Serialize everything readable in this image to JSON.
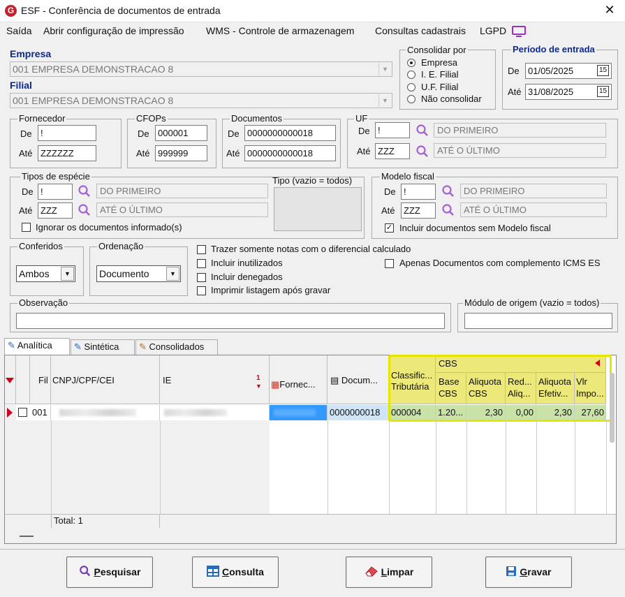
{
  "window": {
    "title": "ESF - Conferência de documentos de entrada",
    "logo_letter": "G"
  },
  "menu": [
    "Saída",
    "Abrir configuração de impressão",
    "WMS - Controle de armazenagem",
    "Consultas cadastrais",
    "LGPD"
  ],
  "empresa": {
    "label": "Empresa",
    "value": "001 EMPRESA DEMONSTRACAO 8"
  },
  "filial": {
    "label": "Filial",
    "value": "001 EMPRESA DEMONSTRACAO 8"
  },
  "consolidar": {
    "title": "Consolidar por",
    "options": [
      "Empresa",
      "I. E. Filial",
      "U.F. Filial",
      "Não consolidar"
    ],
    "selected": "Empresa"
  },
  "periodo": {
    "title": "Período de entrada",
    "de_label": "De",
    "de": "01/05/2025",
    "ate_label": "Até",
    "ate": "31/08/2025",
    "cal_icon_text": "15"
  },
  "fornecedor": {
    "title": "Fornecedor",
    "de_label": "De",
    "de": "!",
    "ate_label": "Até",
    "ate": "ZZZZZZ"
  },
  "cfops": {
    "title": "CFOPs",
    "de_label": "De",
    "de": "000001",
    "ate_label": "Até",
    "ate": "999999"
  },
  "documentos": {
    "title": "Documentos",
    "de_label": "De",
    "de": "0000000000018",
    "ate_label": "Até",
    "ate": "0000000000018"
  },
  "uf": {
    "title": "UF",
    "de_label": "De",
    "de": "!",
    "de_desc": "DO PRIMEIRO",
    "ate_label": "Até",
    "ate": "ZZZ",
    "ate_desc": "ATÉ O ÚLTIMO"
  },
  "especie": {
    "title": "Tipos de espécie",
    "de_label": "De",
    "de": "!",
    "de_desc": "DO PRIMEIRO",
    "ate_label": "Até",
    "ate": "ZZZ",
    "ate_desc": "ATÉ O ÚLTIMO",
    "tipo_title": "Tipo (vazio = todos)",
    "ignorar_label": "Ignorar os documentos informado(s)",
    "ignorar_checked": false
  },
  "modelo": {
    "title": "Modelo fiscal",
    "de_label": "De",
    "de": "!",
    "de_desc": "DO PRIMEIRO",
    "ate_label": "Até",
    "ate": "ZZZ",
    "ate_desc": "ATÉ O ÚLTIMO",
    "incluir_label": "Incluir documentos sem Modelo fiscal",
    "incluir_checked": true
  },
  "conferidos": {
    "title": "Conferidos",
    "value": "Ambos"
  },
  "ordenacao": {
    "title": "Ordenação",
    "value": "Documento"
  },
  "options": {
    "trazer": "Trazer somente notas com o diferencial calculado",
    "inutilizados": "Incluir inutilizados",
    "denegados": "Incluir denegados",
    "imprimir": "Imprimir listagem após gravar",
    "apenas": "Apenas Documentos com complemento ICMS ES"
  },
  "observacao": {
    "title": "Observação",
    "value": ""
  },
  "modulo": {
    "title": "Módulo de origem (vazio = todos)",
    "value": ""
  },
  "tabs": [
    "Analítica",
    "Sintética",
    "Consolidados"
  ],
  "grid": {
    "headers": {
      "fil": "Fil",
      "cnpj": "CNPJ/CPF/CEI",
      "ie": "IE",
      "ie_sort": "1",
      "fornec": "Fornec...",
      "docum": "Docum...",
      "classific_1": "Classific...",
      "classific_2": "Tributária",
      "cbs_group": "CBS",
      "base_1": "Base",
      "base_2": "CBS",
      "aliq_1": "Aliquota",
      "aliq_2": "CBS",
      "red_1": "Red...",
      "red_2": "Aliq...",
      "aliqef_1": "Aliquota",
      "aliqef_2": "Efetiv...",
      "vlr_1": "Vlr",
      "vlr_2": "Impo..."
    },
    "row": {
      "fil": "001",
      "documento": "0000000018",
      "classific": "000004",
      "base": "1.20...",
      "aliq": "2,30",
      "red": "0,00",
      "aliq_ef": "2,30",
      "vlr": "27,60"
    },
    "footer": "Total: 1"
  },
  "buttons": {
    "pesquisar": {
      "first": "P",
      "rest": "esquisar"
    },
    "consulta": {
      "first": "C",
      "rest": "onsulta"
    },
    "limpar": {
      "first": "L",
      "rest": "impar"
    },
    "gravar": {
      "first": "G",
      "rest": "ravar"
    }
  },
  "colors": {
    "highlight": "#ece97a",
    "highlight_border": "#e5e500",
    "blue_label": "#0d2a8a",
    "selection": "#3399ff",
    "red_marker": "#d0021b"
  }
}
